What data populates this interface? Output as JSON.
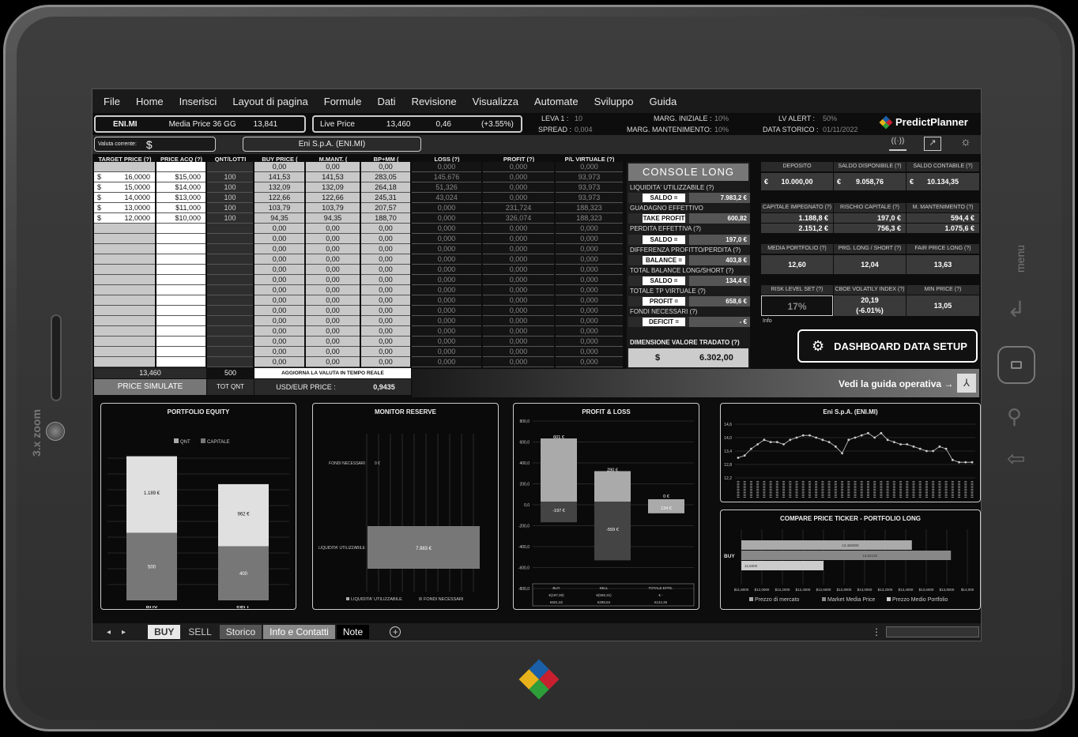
{
  "menu": [
    "File",
    "Home",
    "Inserisci",
    "Layout di pagina",
    "Formule",
    "Dati",
    "Revisione",
    "Visualizza",
    "Automate",
    "Sviluppo",
    "Guida"
  ],
  "header": {
    "ticker": "ENI.MI",
    "media_price_label": "Media Price 36 GG",
    "media_price_value": "13,841",
    "live_price_label": "Live Price",
    "live_price_value": "13,460",
    "live_change": "0,46",
    "live_change_pct": "(+3.55%)",
    "leva_label": "LEVA 1 :",
    "leva_value": "10",
    "spread_label": "SPREAD :",
    "spread_value": "0,004",
    "marg_iniz_label": "MARG. INIZIALE :",
    "marg_iniz_value": "10%",
    "marg_mant_label": "MARG. MANTENIMENTO:",
    "marg_mant_value": "10%",
    "lv_alert_label": "LV ALERT :",
    "lv_alert_value": "50%",
    "data_storico_label": "DATA STORICO :",
    "data_storico_value": "01/11/2022",
    "brand": "PredictPlanner",
    "valuta_label": "Valuta corrente:",
    "valuta_value": "$",
    "company": "Eni S.p.A. (ENI.MI)"
  },
  "table": {
    "headers": [
      "TARGET PRICE (?)",
      "PRICE ACQ (?)",
      "QNT/LOTTI",
      "BUY PRICE (",
      "M.MANT. (",
      "BP+MM (",
      "LOSS (?)",
      "PROFIT (?)",
      "P/L VIRTUALE (?)"
    ],
    "rows": [
      [
        "",
        "",
        "",
        "0,00",
        "0,00",
        "0,00",
        "0,000",
        "0,000",
        "0,000"
      ],
      [
        "16,0000",
        "$15,000",
        "100",
        "141,53",
        "141,53",
        "283,05",
        "145,676",
        "0,000",
        "93,973"
      ],
      [
        "15,0000",
        "$14,000",
        "100",
        "132,09",
        "132,09",
        "264,18",
        "51,326",
        "0,000",
        "93,973"
      ],
      [
        "14,0000",
        "$13,000",
        "100",
        "122,66",
        "122,66",
        "245,31",
        "43,024",
        "0,000",
        "93,973"
      ],
      [
        "13,0000",
        "$11,000",
        "100",
        "103,79",
        "103,79",
        "207,57",
        "0,000",
        "231,724",
        "188,323"
      ],
      [
        "12,0000",
        "$10,000",
        "100",
        "94,35",
        "94,35",
        "188,70",
        "0,000",
        "326,074",
        "188,323"
      ]
    ],
    "empty_row": [
      "0,00",
      "0,00",
      "0,00",
      "0,000",
      "0,000",
      "0,000"
    ],
    "footer_price": "13,460",
    "footer_qnt": "500",
    "footer_update": "AGGIORNA LA VALUTA IN TEMPO REALE",
    "price_simulate": "PRICE SIMULATE",
    "tot_qnt": "TOT QNT",
    "usd_eur_label": "USD/EUR PRICE :",
    "usd_eur_value": "0,9435"
  },
  "console": {
    "title": "CONSOLE LONG",
    "rows": [
      {
        "label": "LIQUIDITA' UTILIZZABILE (?)",
        "value": ""
      },
      {
        "label": "SALDO =",
        "value": "7.983,2 €"
      },
      {
        "label": "GUADAGNO EFFETTIVO",
        "value": ""
      },
      {
        "label": "TAKE PROFIT =",
        "value": "600,82"
      },
      {
        "label": "PERDITA EFFETTIVA (?)",
        "value": ""
      },
      {
        "label": "SALDO =",
        "value": "197,0 €"
      },
      {
        "label": "DIFFERENZA PROFITTO/PERDITA (?)",
        "value": ""
      },
      {
        "label": "BALANCE =",
        "value": "403,8 €"
      },
      {
        "label": "TOTAL BALANCE LONG/SHORT (?)",
        "value": ""
      },
      {
        "label": "SALDO =",
        "value": "134,4 €"
      },
      {
        "label": "TOTALE TP VIRTUALE (?)",
        "value": ""
      },
      {
        "label": "PROFIT =",
        "value": "658,6 €"
      },
      {
        "label": "FONDI NECESSARI (?)",
        "value": ""
      },
      {
        "label": "DEFICIT =",
        "value": "- €"
      }
    ],
    "dim_label": "DIMENSIONE VALORE TRADATO (?)",
    "dim_currency": "$",
    "dim_value": "6.302,00"
  },
  "kpi": {
    "r1h": [
      "DEPOSITO",
      "SALDO DISPONIBILE (?)",
      "SALDO CONTABILE (?)"
    ],
    "r1v": [
      "10.000,00",
      "9.058,76",
      "10.134,35"
    ],
    "r2h": [
      "CAPITALE IMPEGNATO (?)",
      "RISCHIO CAPITALE (?)",
      "M. MANTENIMENTO (?)"
    ],
    "r2v": [
      "1.188,8 €",
      "197,0 €",
      "594,4 €"
    ],
    "r2v2": [
      "2.151,2 €",
      "756,3 €",
      "1.075,6 €"
    ],
    "r3h": [
      "MEDIA PORTFOLIO (?)",
      "PRG. LONG / SHORT (?)",
      "FAIR PRICE LONG (?)"
    ],
    "r3v": [
      "12,60",
      "12,04",
      "13,63"
    ],
    "r4h": [
      "RISK LEVEL SET (?)",
      "CBOE VOLATILY INDEX (?)",
      "MIN PRICE (?)"
    ],
    "r4v": [
      "17%",
      "20,19",
      "13,05"
    ],
    "r4v2": "(-6.01%)",
    "info": "Info",
    "euro": "€",
    "dashboard_btn": "DASHBOARD DATA SETUP",
    "guide": "Vedi la guida operativa →"
  },
  "charts": {
    "equity": {
      "title": "PORTFOLIO EQUITY",
      "legend": [
        "QNT",
        "CAPITALE"
      ],
      "cats": [
        "BUY",
        "SELL"
      ],
      "qnt": [
        500,
        400
      ],
      "cap_labels": [
        "1.189 €",
        "962 €"
      ],
      "qnt_labels": [
        "500",
        "400"
      ]
    },
    "reserve": {
      "title": "MONITOR RESERVE",
      "labels": [
        "FONDI NECESSARI",
        "LIQUIDITA' UTILIZZABILE"
      ],
      "value_labels": [
        "0 €",
        "7.983 €"
      ],
      "legend": [
        "LIQUIDITA' UTILIZZABILE",
        "FONDI NECESSARI"
      ]
    },
    "pl": {
      "title": "PROFIT & LOSS",
      "yticks": [
        "800,0",
        "600,0",
        "400,0",
        "200,0",
        "0,0",
        "-200,0",
        "-400,0",
        "-600,0",
        "-800,0"
      ],
      "labels": [
        "601 €",
        "-197 €",
        "290 €",
        "-559 €",
        "0 €",
        "134 €"
      ],
      "tbl_h": [
        "BUY",
        "SELL",
        "TOTALE EFFE."
      ],
      "tbl_r1": [
        "€(197,00)",
        "€(559,31)",
        "€ -"
      ],
      "tbl_r2": [
        "€601,82",
        "€289,84",
        "€134,35"
      ]
    },
    "eni": {
      "title": "Eni S.p.A. (ENI.MI)",
      "yticks": [
        "14,6",
        "14,0",
        "13,4",
        "12,8",
        "12,2"
      ],
      "values": [
        13.1,
        13.2,
        13.5,
        13.7,
        13.9,
        13.8,
        13.8,
        13.7,
        13.9,
        14.0,
        14.1,
        14.1,
        14.0,
        13.9,
        13.8,
        13.6,
        13.3,
        13.9,
        14.0,
        14.1,
        14.2,
        14.0,
        14.2,
        13.9,
        13.8,
        13.7,
        13.7,
        13.6,
        13.5,
        13.4,
        13.4,
        13.6,
        13.5,
        13.0,
        12.9,
        12.9,
        12.9
      ]
    },
    "compare": {
      "title": "COMPARE PRICE TICKER - PORTFOLIO LONG",
      "cat": "BUY",
      "bars": [
        {
          "label": "13,460000",
          "v": 13.46
        },
        {
          "label": "13,84130",
          "v": 13.84
        },
        {
          "label": "12,6000",
          "v": 12.6
        }
      ],
      "xticks": [
        "$11,8000",
        "$12,0000",
        "$12,2000",
        "$12,4000",
        "$12,6000",
        "$12,8000",
        "$13,0000",
        "$13,2000",
        "$13,4000",
        "$13,6000",
        "$13,8000",
        "$14,000"
      ],
      "legend": [
        "Prezzo di mercato",
        "Market Media Price",
        "Prezzo Medio Portfolio"
      ]
    }
  },
  "tabs": [
    "BUY",
    "SELL",
    "Storico",
    "Info e Contatti",
    "Note"
  ],
  "device": {
    "zoom": "3.x zoom",
    "menu": "menu"
  }
}
